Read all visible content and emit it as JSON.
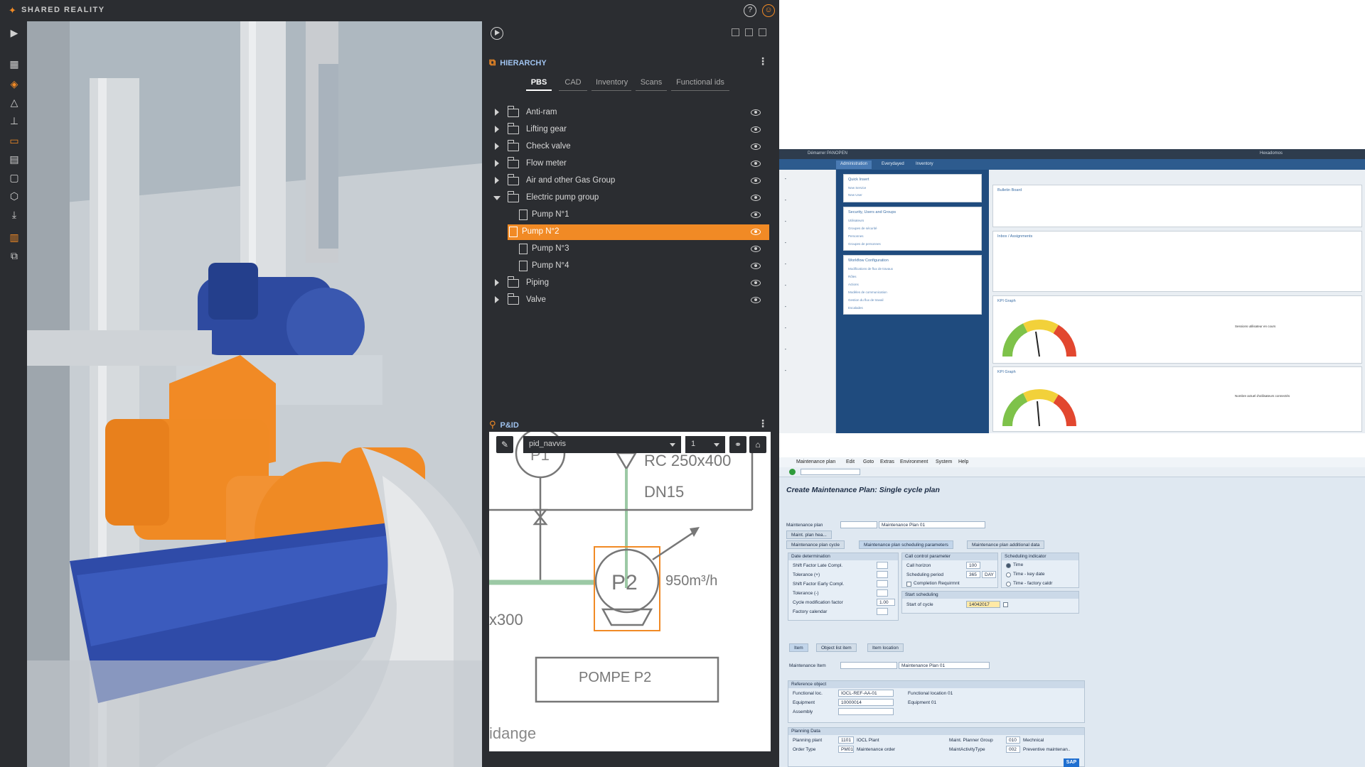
{
  "app": {
    "logo_text": "SHARED REALITY",
    "hierarchy_title": "HIERARCHY",
    "tabs": [
      "PBS",
      "CAD",
      "Inventory",
      "Scans",
      "Functional ids"
    ],
    "active_tab": "PBS",
    "tree": [
      {
        "label": "Anti-ram",
        "type": "folder",
        "expanded": false
      },
      {
        "label": "Lifting gear",
        "type": "folder",
        "expanded": false
      },
      {
        "label": "Check valve",
        "type": "folder",
        "expanded": false
      },
      {
        "label": "Flow meter",
        "type": "folder",
        "expanded": false
      },
      {
        "label": "Air and other Gas Group",
        "type": "folder",
        "expanded": false
      },
      {
        "label": "Electric pump group",
        "type": "folder",
        "expanded": true
      },
      {
        "label": "Pump N°1",
        "type": "item"
      },
      {
        "label": "Pump N°2",
        "type": "item",
        "selected": true
      },
      {
        "label": "Pump N°3",
        "type": "item"
      },
      {
        "label": "Pump N°4",
        "type": "item"
      },
      {
        "label": "Piping",
        "type": "folder",
        "expanded": false
      },
      {
        "label": "Valve",
        "type": "folder",
        "expanded": false
      }
    ],
    "pid_title": "P&ID",
    "pid_select": "pid_navvis",
    "pid_page": "1",
    "pid_labels": {
      "p1": "P1",
      "rc": "RC 250x400",
      "dn": "DN15",
      "p2": "P2",
      "flow": "950m³/h",
      "x300": "x300",
      "pompe": "POMPE P2",
      "idange": "idange"
    },
    "accent": "#f18a25"
  },
  "web": {
    "header": "Démarrer  PANOPEN",
    "header_right": "Hexadomos",
    "tabs": [
      "Administration",
      "Everydayed",
      "Inventory"
    ],
    "cards": {
      "quick": {
        "title": "Quick Insert",
        "lines": [
          "New Service",
          "New User"
        ]
      },
      "security": {
        "title": "Security, Users and Groups",
        "lines": [
          "Utilisateurs",
          "Groupes de sécurité",
          "Personnes",
          "Groupes de personnes"
        ]
      },
      "workflow": {
        "title": "Workflow Configuration",
        "lines": [
          "Modifications de flux de travaux",
          "Rôles",
          "Actions",
          "Modèles de communication",
          "Gestion du flux de travail",
          "Escalades"
        ]
      },
      "bulletin": {
        "title": "Bulletin Board"
      },
      "inbox": {
        "title": "Inbox / Assignments"
      },
      "kpi1": {
        "title": "KPI Graph",
        "label": "Sessions utilisateur en cours"
      },
      "kpi2": {
        "title": "KPI Graph",
        "label": "Nombre actuel d'utilisateurs connectés"
      }
    }
  },
  "sap": {
    "menu": [
      "Maintenance plan",
      "Edit",
      "Goto",
      "Extras",
      "Environment",
      "System",
      "Help"
    ],
    "title": "Create Maintenance Plan: Single cycle plan",
    "maintenance_plan_label": "Maintenance plan",
    "maintenance_plan_value": "Maintenance Plan 01",
    "maint_plan_header_btn": "Maint. plan hea...",
    "tabs": [
      "Maintenance plan cycle",
      "Maintenance plan scheduling parameters",
      "Maintenance plan additional data"
    ],
    "date_determination": {
      "title": "Date determination",
      "rows": [
        "Shift Factor Late Compl.",
        "Tolerance (+)",
        "Shift Factor Early Compl.",
        "Tolerance (-)",
        "Cycle modification factor",
        "Factory calendar"
      ],
      "cycle_factor": "1.00"
    },
    "call_control": {
      "title": "Call control parameter",
      "rows": [
        "Call horizon",
        "Scheduling period",
        "Completion Requirmnt"
      ],
      "call_horizon": "100",
      "scheduling_period": "365",
      "scheduling_unit": "DAY"
    },
    "scheduling_indicator": {
      "title": "Scheduling indicator",
      "options": [
        "Time",
        "Time - key date",
        "Time - factory caldr"
      ]
    },
    "start_scheduling": {
      "title": "Start scheduling",
      "label": "Start of cycle",
      "value": "14042017"
    },
    "item_tabs": [
      "Item",
      "Object list item",
      "Item location"
    ],
    "maintenance_item_label": "Maintenance Item",
    "maintenance_item_value": "Maintenance Plan 01",
    "reference_object": {
      "title": "Reference object",
      "rows": [
        {
          "label": "Functional loc.",
          "value": "IOCL-REF-AA-01",
          "desc": "Functional location 01"
        },
        {
          "label": "Equipment",
          "value": "10000014",
          "desc": "Equipment 01"
        },
        {
          "label": "Assembly",
          "value": "",
          "desc": ""
        }
      ]
    },
    "planning_data": {
      "title": "Planning Data",
      "rows": [
        {
          "label": "Planning plant",
          "value": "1101",
          "desc": "IOCL Plant",
          "label2": "Maint. Planner Group",
          "value2": "010",
          "desc2": "Mechnical"
        },
        {
          "label": "Order Type",
          "value": "PM01",
          "desc": "Maintenance order",
          "label2": "MaintActivityType",
          "value2": "002",
          "desc2": "Preventive maintenan.."
        }
      ]
    },
    "brand": "SAP"
  }
}
